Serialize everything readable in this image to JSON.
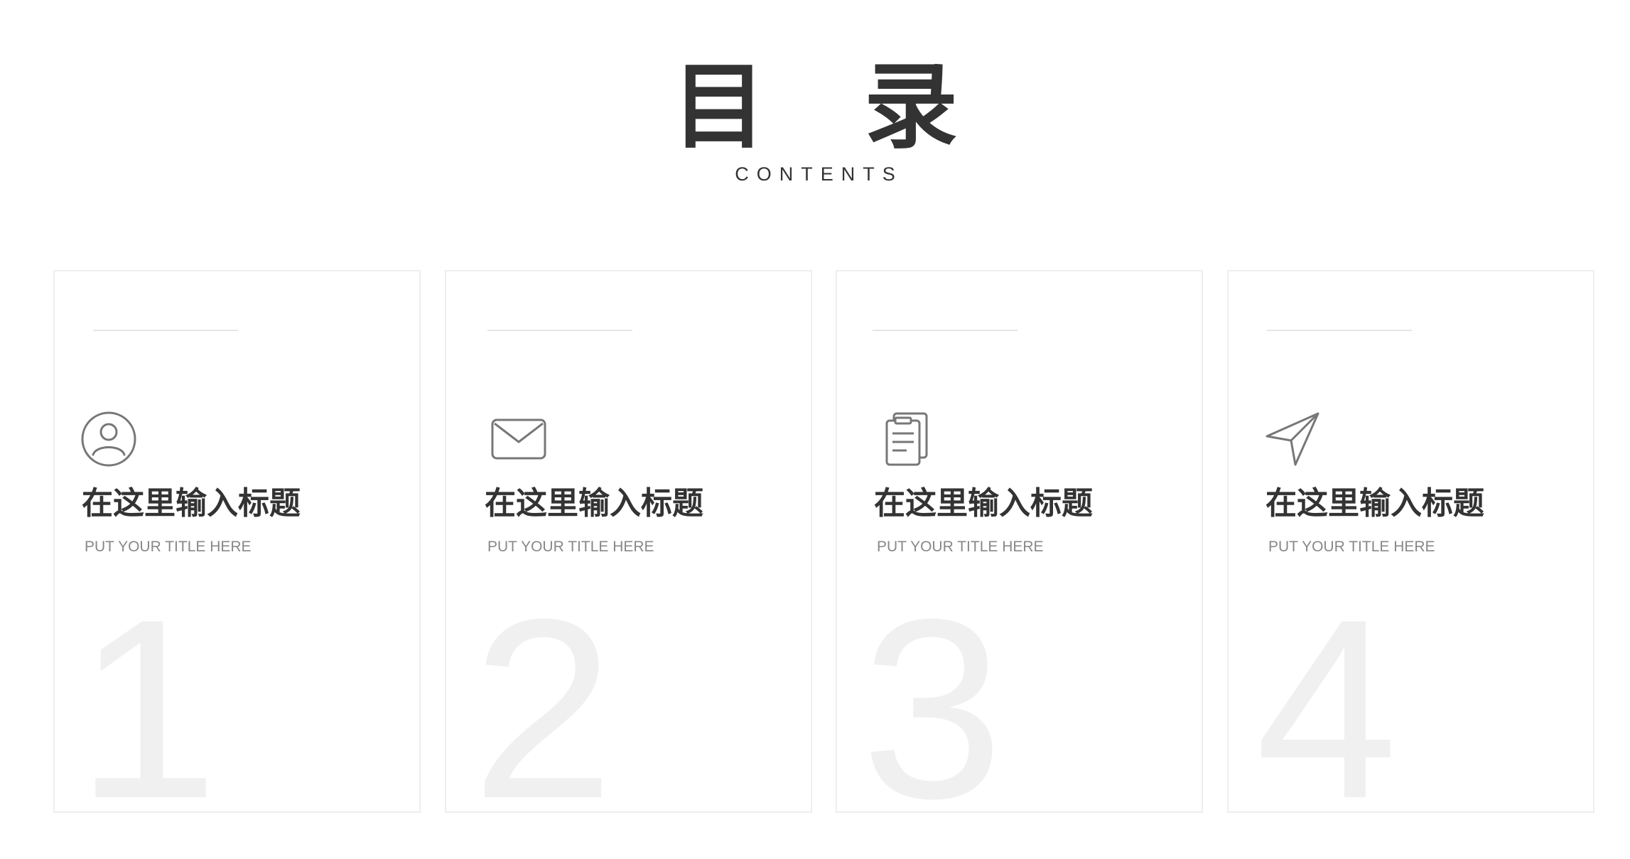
{
  "header": {
    "title": "目 录",
    "subtitle": "CONTENTS"
  },
  "cards": [
    {
      "icon": "user-icon",
      "title": "在这里输入标题",
      "subtitle": "PUT YOUR TITLE HERE",
      "number": "1"
    },
    {
      "icon": "mail-icon",
      "title": "在这里输入标题",
      "subtitle": "PUT YOUR TITLE HERE",
      "number": "2"
    },
    {
      "icon": "clipboard-icon",
      "title": "在这里输入标题",
      "subtitle": "PUT YOUR TITLE HERE",
      "number": "3"
    },
    {
      "icon": "send-icon",
      "title": "在这里输入标题",
      "subtitle": "PUT YOUR TITLE HERE",
      "number": "4"
    }
  ],
  "colors": {
    "text_dark": "#333333",
    "text_muted": "#888888",
    "number": "#f0f0f0",
    "border": "#eeeeee",
    "icon": "#777777"
  }
}
